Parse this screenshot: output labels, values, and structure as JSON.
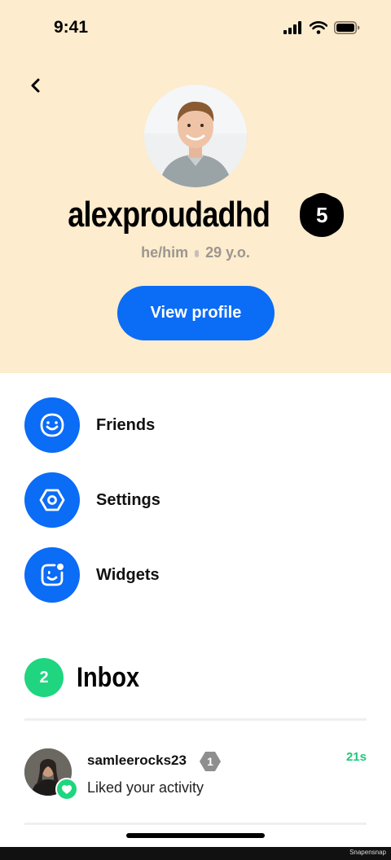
{
  "status_bar": {
    "time": "9:41"
  },
  "profile": {
    "username": "alexproudadhd",
    "level": "5",
    "pronouns": "he/him",
    "age": "29 y.o.",
    "view_profile_label": "View profile"
  },
  "menu": [
    {
      "label": "Friends",
      "icon": "smile-icon"
    },
    {
      "label": "Settings",
      "icon": "hexagon-gear-icon"
    },
    {
      "label": "Widgets",
      "icon": "widget-face-icon"
    }
  ],
  "inbox": {
    "title": "Inbox",
    "count": "2",
    "items": [
      {
        "username": "samleerocks23",
        "level": "1",
        "text": "Liked your activity",
        "time": "21s",
        "reaction_icon": "heart-icon"
      }
    ]
  },
  "watermark": "Snapensnap",
  "colors": {
    "accent": "#0b6cf6",
    "header_bg": "#fdeccd",
    "success": "#1fd57f"
  }
}
